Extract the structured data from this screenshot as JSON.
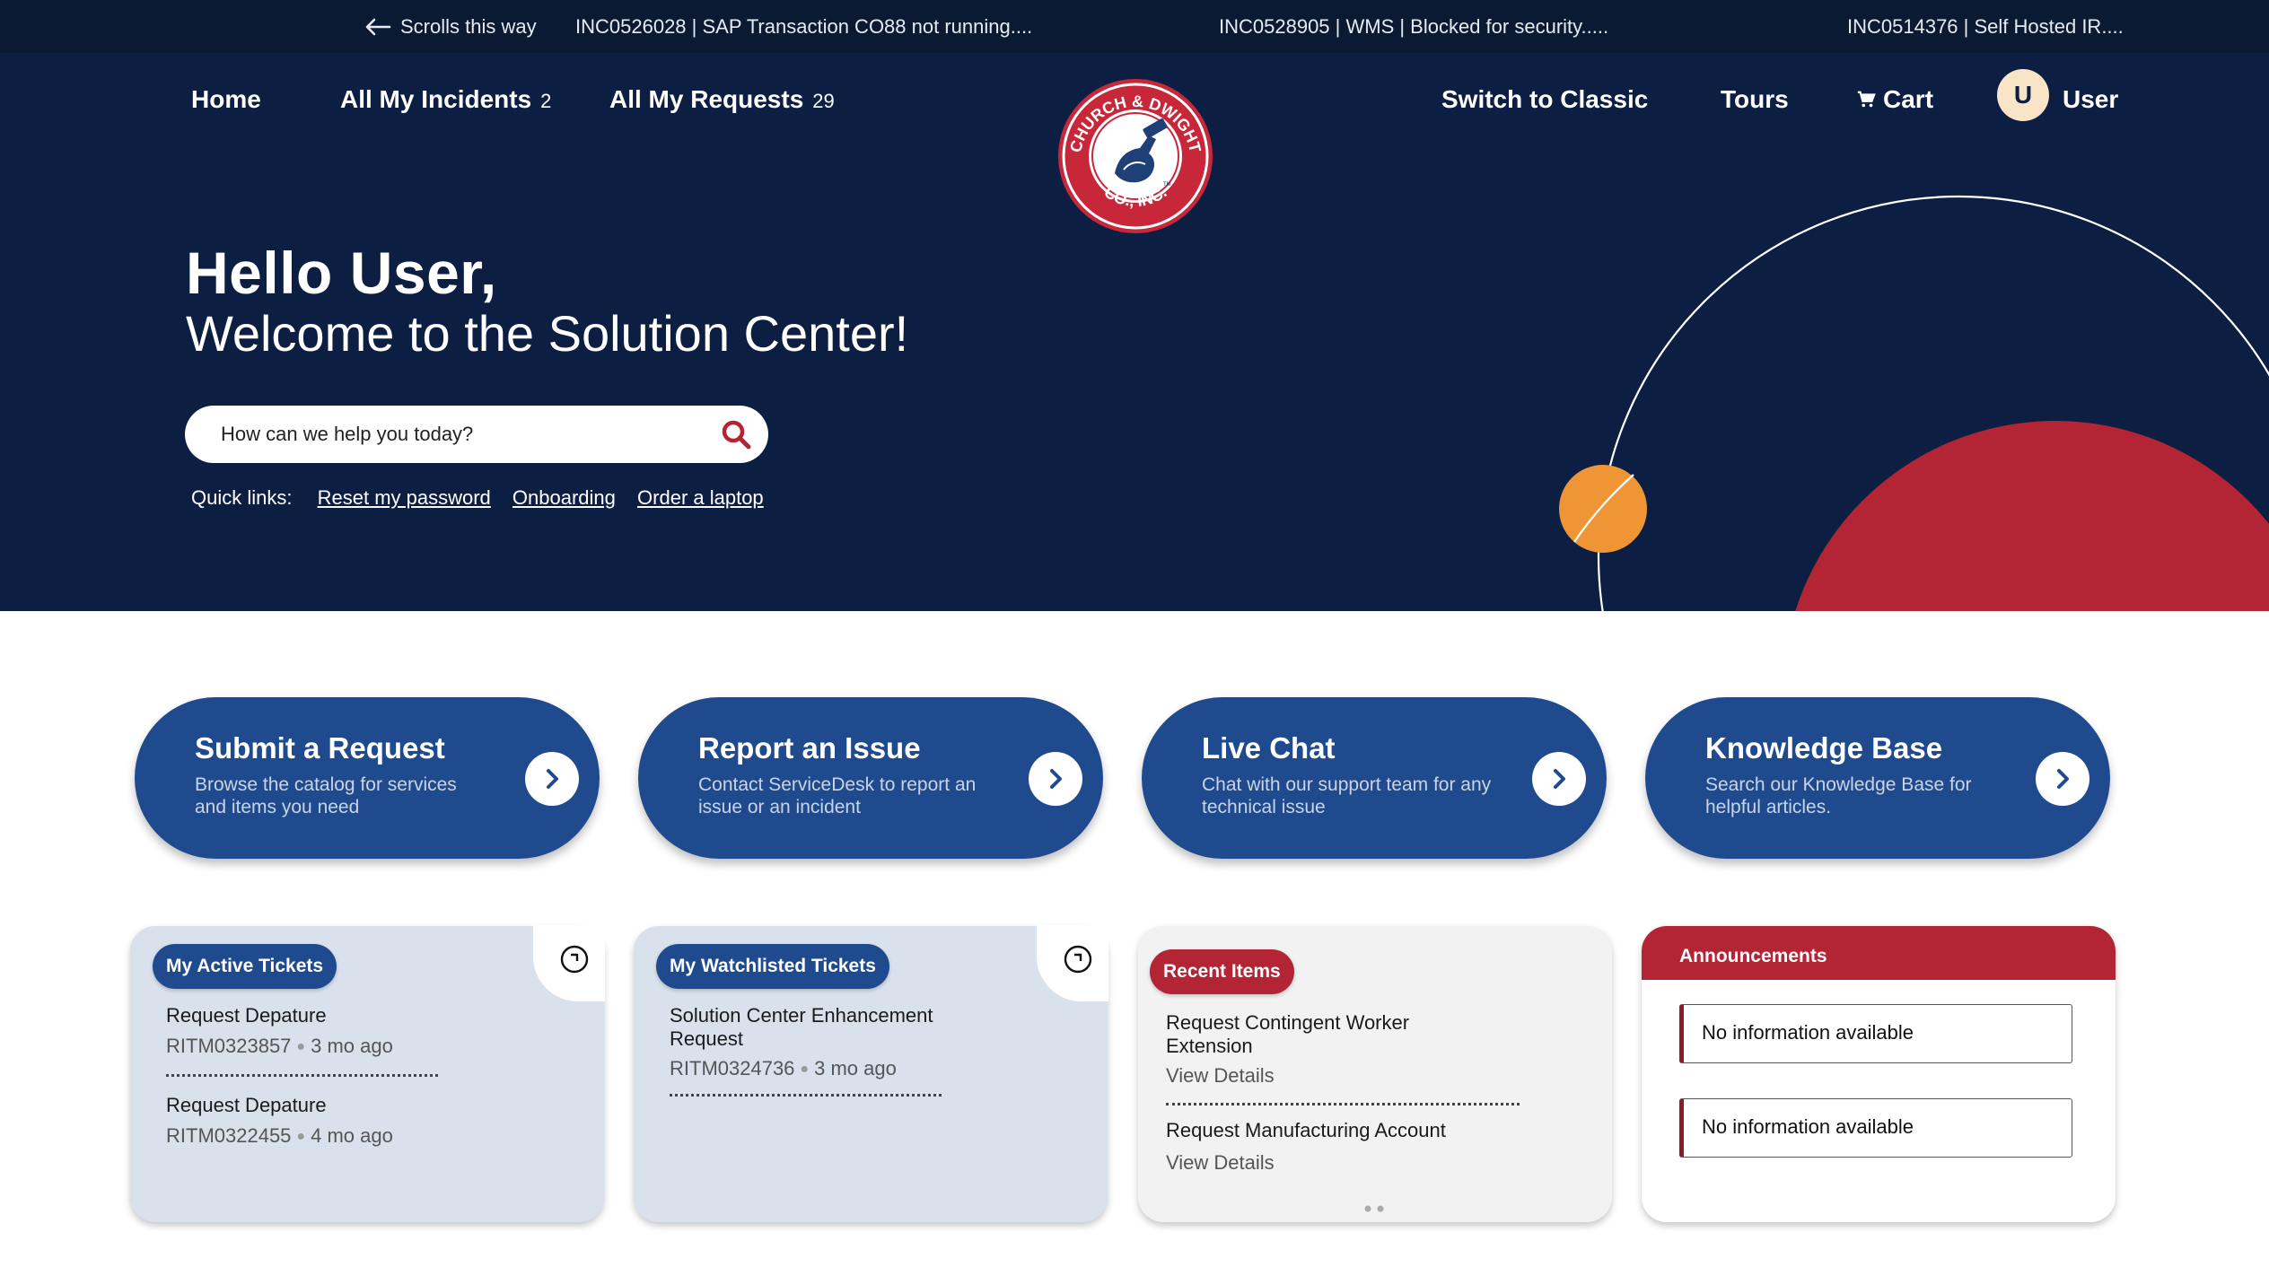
{
  "ticker": {
    "scroll_hint": "Scrolls this way",
    "items": [
      "INC0526028 | SAP Transaction CO88 not running....",
      "INC0528905 | WMS | Blocked for security.....",
      "INC0514376 | Self Hosted IR...."
    ]
  },
  "nav": {
    "home": "Home",
    "incidents_label": "All My Incidents",
    "incidents_count": "2",
    "requests_label": "All My Requests",
    "requests_count": "29",
    "switch_classic": "Switch to Classic",
    "tours": "Tours",
    "cart": "Cart",
    "avatar_initial": "U",
    "user": "User"
  },
  "logo": {
    "top_text": "CHURCH & DWIGHT",
    "bottom_text": "CO., INC.",
    "tm": "TM"
  },
  "hero": {
    "greeting": "Hello User,",
    "welcome": "Welcome to the Solution Center!",
    "search_placeholder": "How can we help you today?",
    "quick_links_label": "Quick links:",
    "quick_links": [
      "Reset my password",
      "Onboarding",
      "Order a laptop"
    ]
  },
  "actions": [
    {
      "title": "Submit a Request",
      "desc": "Browse the catalog for services and items you need"
    },
    {
      "title": "Report an Issue",
      "desc": "Contact ServiceDesk to report an issue or an incident"
    },
    {
      "title": "Live Chat",
      "desc": "Chat with our support team for any technical issue"
    },
    {
      "title": "Knowledge Base",
      "desc": "Search our Knowledge Base for helpful articles."
    }
  ],
  "active_tickets": {
    "title": "My Active Tickets",
    "items": [
      {
        "name": "Request Depature",
        "number": "RITM0323857",
        "age": "3 mo ago"
      },
      {
        "name": "Request Depature",
        "number": "RITM0322455",
        "age": "4 mo ago"
      }
    ]
  },
  "watchlisted": {
    "title": "My Watchlisted Tickets",
    "items": [
      {
        "name": "Solution Center Enhancement Request",
        "number": "RITM0324736",
        "age": "3 mo ago"
      }
    ]
  },
  "recent": {
    "title": "Recent Items",
    "items": [
      {
        "name": "Request Contingent Worker Extension",
        "link": "View Details"
      },
      {
        "name": "Request Manufacturing Account",
        "link": "View Details"
      }
    ]
  },
  "announcements": {
    "title": "Announcements",
    "items": [
      "No information available",
      "No information available"
    ]
  },
  "colors": {
    "ticker_bg": "#0b1a33",
    "hero_bg": "#0c1f43",
    "brand_blue": "#1f4b8e",
    "brand_red": "#b32535",
    "accent_orange": "#ef9535"
  },
  "icons": {
    "scroll": "arrow-left-icon",
    "cart": "cart-icon",
    "search": "search-icon",
    "action_arrow": "chevron-right-icon",
    "refresh": "refresh-icon"
  }
}
